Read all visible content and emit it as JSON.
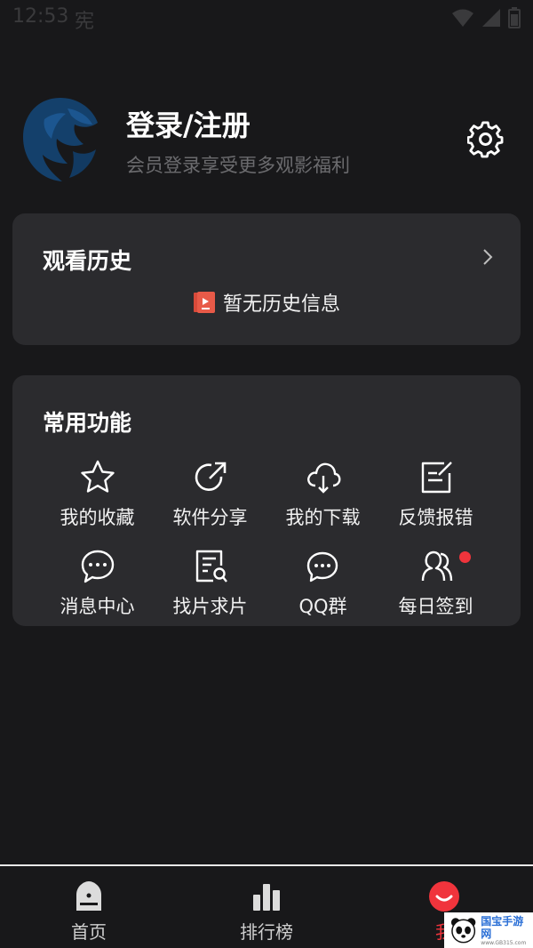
{
  "status_bar": {
    "time": "12:53",
    "glyph": "宪"
  },
  "profile": {
    "title": "登录/注册",
    "subtitle": "会员登录享受更多观影福利"
  },
  "history": {
    "title": "观看历史",
    "empty_text": "暂无历史信息"
  },
  "functions": {
    "title": "常用功能",
    "items": [
      {
        "label": "我的收藏",
        "icon": "star-icon"
      },
      {
        "label": "软件分享",
        "icon": "share-icon"
      },
      {
        "label": "我的下载",
        "icon": "cloud-download-icon"
      },
      {
        "label": "反馈报错",
        "icon": "feedback-icon"
      },
      {
        "label": "消息中心",
        "icon": "chat-bubble-icon"
      },
      {
        "label": "找片求片",
        "icon": "search-document-icon"
      },
      {
        "label": "QQ群",
        "icon": "group-chat-icon"
      },
      {
        "label": "每日签到",
        "icon": "users-icon",
        "has_badge": true
      }
    ]
  },
  "tabs": [
    {
      "label": "首页",
      "icon": "home-icon"
    },
    {
      "label": "排行榜",
      "icon": "bar-chart-icon"
    },
    {
      "label": "我",
      "icon": "smile-icon",
      "active": true
    }
  ],
  "watermark": {
    "text": "国宝手游网",
    "url": "www.GB315.com"
  },
  "colors": {
    "accent": "#f0343c",
    "card": "#2b2b2e",
    "background": "#18181a"
  }
}
